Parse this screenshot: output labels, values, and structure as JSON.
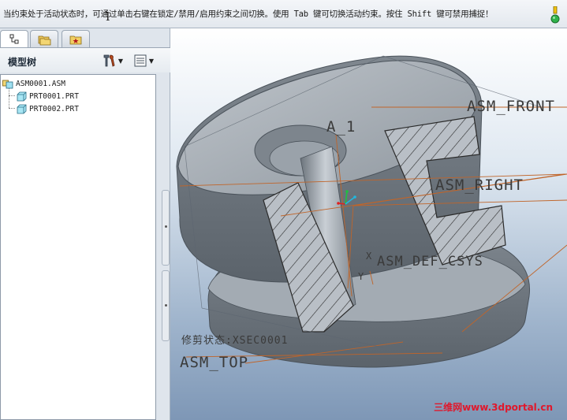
{
  "message_bar": {
    "message": "当约束处于活动状态时，可通过单击右键在锁定/禁用/启用约束之间切换。使用 Tab 键可切换活动约束。按住 Shift 键可禁用捕捉！"
  },
  "left_panel": {
    "tabs": [
      {
        "icon": "model-tree-tab-icon"
      },
      {
        "icon": "folder-browser-tab-icon"
      },
      {
        "icon": "favorites-tab-icon"
      }
    ],
    "tree_title": "模型树",
    "tree_items": [
      {
        "label": "ASM0001.ASM",
        "icon": "assembly-icon",
        "level": 0
      },
      {
        "label": "PRT0001.PRT",
        "icon": "part-icon",
        "level": 1
      },
      {
        "label": "PRT0002.PRT",
        "icon": "part-icon",
        "level": 1
      }
    ]
  },
  "viewport": {
    "datum_labels": {
      "asm_front": "ASM_FRONT",
      "asm_right": "ASM_RIGHT",
      "asm_top": "ASM_TOP",
      "axis": "A_1",
      "csys": "ASM_DEF_CSYS",
      "csys_x": "X",
      "csys_y": "Y"
    },
    "section_status": "修剪状态:XSEC0001",
    "watermark": "三维网www.3dportal.cn",
    "colors": {
      "part_gray": "#9ca4ac",
      "datum_orange": "#c0652a",
      "hatch_dark": "#2a2a2a"
    }
  }
}
